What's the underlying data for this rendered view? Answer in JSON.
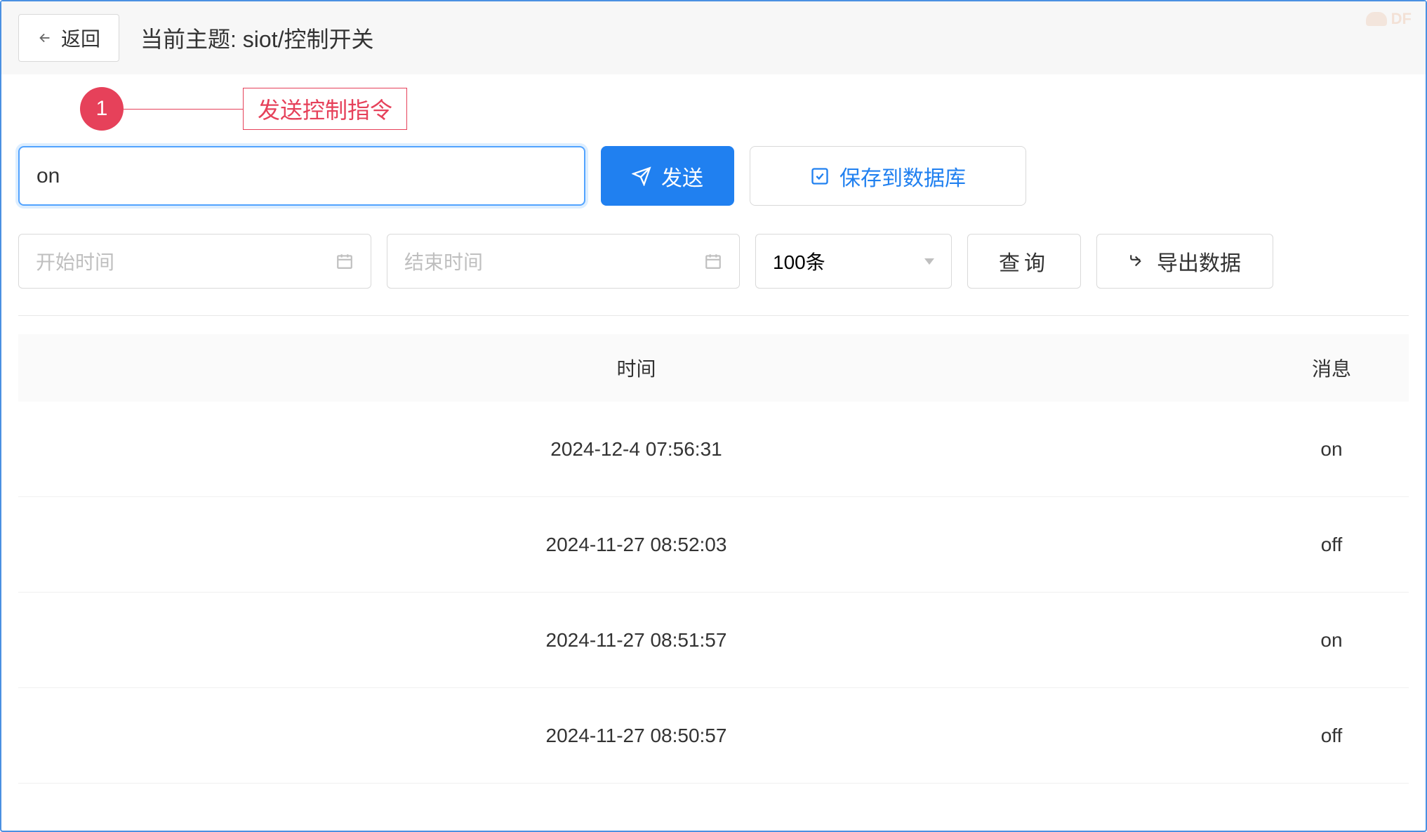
{
  "header": {
    "back_label": "返回",
    "title": "当前主题: siot/控制开关"
  },
  "annotation": {
    "number": "1",
    "label": "发送控制指令"
  },
  "command": {
    "input_value": "on",
    "send_label": "发送",
    "save_label": "保存到数据库"
  },
  "filters": {
    "start_placeholder": "开始时间",
    "end_placeholder": "结束时间",
    "limit_selected": "100条",
    "query_label": "查询",
    "export_label": "导出数据"
  },
  "table": {
    "columns": {
      "time": "时间",
      "message": "消息"
    },
    "rows": [
      {
        "time": "2024-12-4 07:56:31",
        "message": "on"
      },
      {
        "time": "2024-11-27 08:52:03",
        "message": "off"
      },
      {
        "time": "2024-11-27 08:51:57",
        "message": "on"
      },
      {
        "time": "2024-11-27 08:50:57",
        "message": "off"
      }
    ]
  },
  "watermark": "DF"
}
